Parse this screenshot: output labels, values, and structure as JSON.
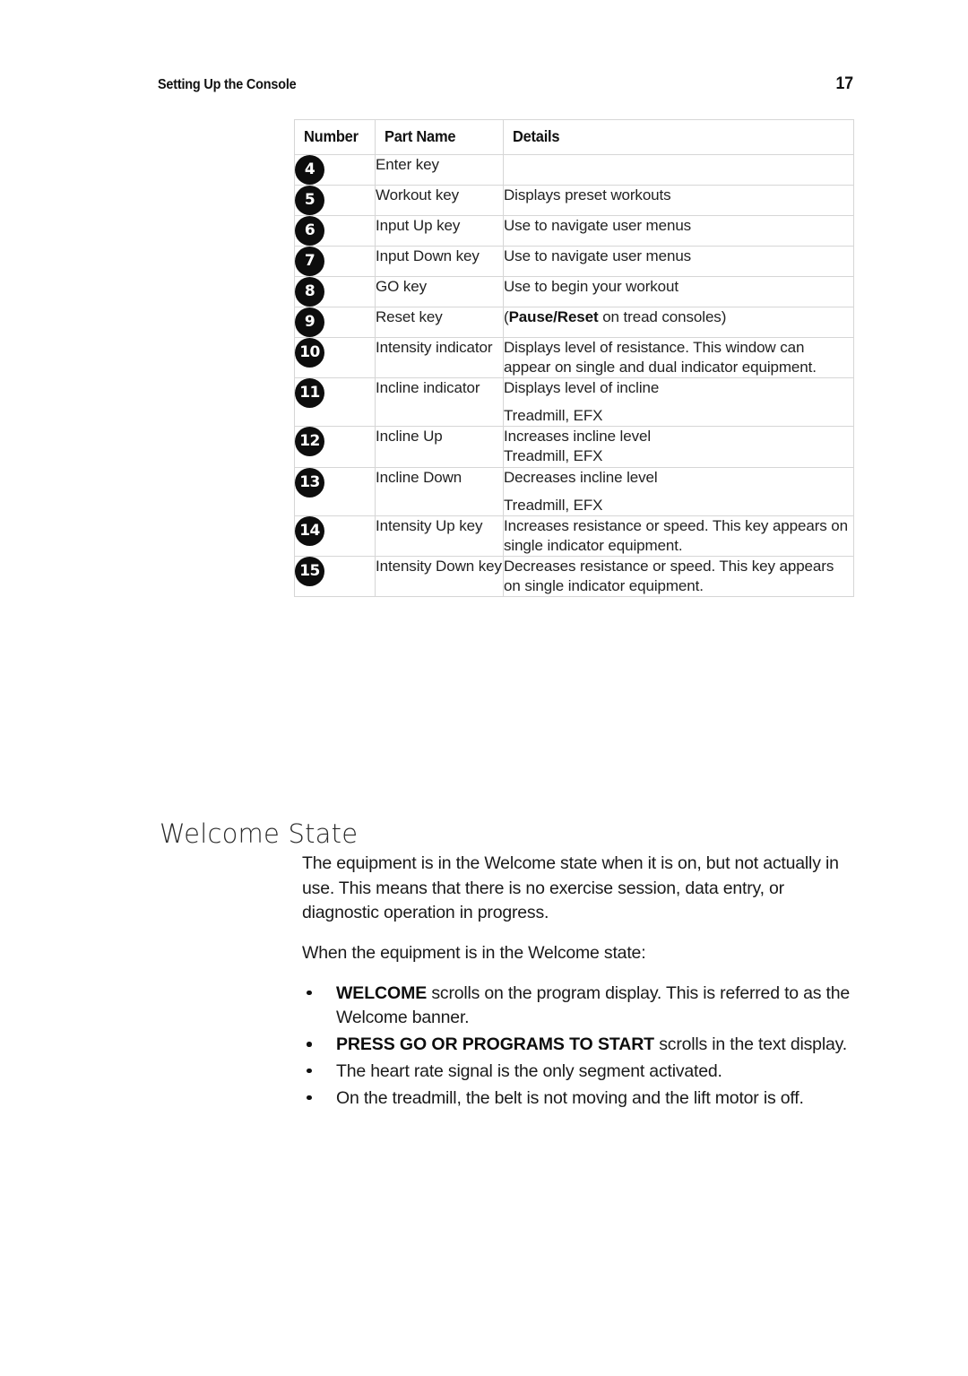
{
  "header": {
    "title": "Setting Up the Console",
    "page_number": "17"
  },
  "table": {
    "columns": [
      "Number",
      "Part Name",
      "Details"
    ],
    "rows": [
      {
        "number": "4",
        "part_name": "Enter key",
        "details": []
      },
      {
        "number": "5",
        "part_name": "Workout key",
        "details": [
          "Displays preset workouts"
        ]
      },
      {
        "number": "6",
        "part_name": "Input Up key",
        "details": [
          "Use to navigate user menus"
        ]
      },
      {
        "number": "7",
        "part_name": "Input Down key",
        "details": [
          "Use to navigate user menus"
        ]
      },
      {
        "number": "8",
        "part_name": "GO key",
        "details": [
          "Use to begin your workout"
        ]
      },
      {
        "number": "9",
        "part_name": "Reset key",
        "details": [
          "(Pause/Reset on tread consoles)"
        ],
        "details_html": "(<b>Pause/Reset</b> on tread consoles)"
      },
      {
        "number": "10",
        "part_name": "Intensity indicator",
        "details": [
          "Displays level of resistance. This window can appear on single and dual indicator equipment."
        ]
      },
      {
        "number": "11",
        "part_name": "Incline indicator",
        "details": [
          "Displays level of incline",
          "Treadmill, EFX"
        ],
        "spaced": true
      },
      {
        "number": "12",
        "part_name": "Incline Up",
        "details": [
          "Increases incline level",
          "Treadmill, EFX"
        ]
      },
      {
        "number": "13",
        "part_name": "Incline Down",
        "details": [
          "Decreases incline level",
          "Treadmill, EFX"
        ],
        "spaced": true
      },
      {
        "number": "14",
        "part_name": "Intensity Up key",
        "details": [
          "Increases resistance or speed. This key appears on single indicator equipment."
        ]
      },
      {
        "number": "15",
        "part_name": "Intensity Down key",
        "details": [
          "Decreases resistance or speed. This key appears on single indicator equipment."
        ]
      }
    ]
  },
  "section": {
    "heading": "Welcome State",
    "paragraphs": [
      "The equipment is in the Welcome state when it is on, but not actually in use. This means that there is no exercise session, data entry, or diagnostic operation in progress.",
      "When the equipment is in the Welcome state:"
    ],
    "bullets": [
      {
        "bold": "WELCOME",
        "text": " scrolls on the program display. This is referred to as the Welcome banner."
      },
      {
        "bold": "PRESS GO OR PROGRAMS TO START",
        "text": " scrolls in the text display."
      },
      {
        "bold": "",
        "text": "The heart rate signal is the only segment activated."
      },
      {
        "bold": "",
        "text": "On the treadmill, the belt is not moving and the lift motor is off."
      }
    ]
  },
  "colors": {
    "badge_fill": "#0d0d0d",
    "badge_text": "#ffffff",
    "table_border": "#d6d6d6",
    "text": "#1a1a1a",
    "page_background": "#ffffff"
  }
}
